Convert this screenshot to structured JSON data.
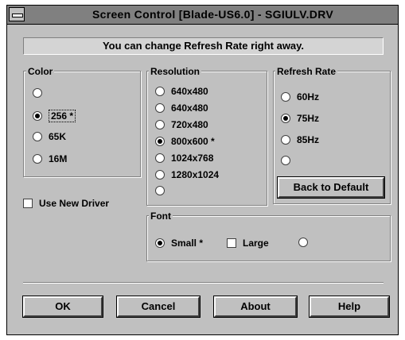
{
  "window": {
    "title": "Screen Control [Blade-US6.0] - SGIULV.DRV"
  },
  "info_message": "You can change Refresh Rate right away.",
  "color": {
    "title": "Color",
    "options": [
      {
        "label": "",
        "checked": false
      },
      {
        "label": "256 *",
        "checked": true
      },
      {
        "label": "65K",
        "checked": false
      },
      {
        "label": "16M",
        "checked": false
      }
    ]
  },
  "resolution": {
    "title": "Resolution",
    "options": [
      {
        "label": "640x480",
        "checked": false
      },
      {
        "label": "640x480",
        "checked": false
      },
      {
        "label": "720x480",
        "checked": false
      },
      {
        "label": "800x600 *",
        "checked": true
      },
      {
        "label": "1024x768",
        "checked": false
      },
      {
        "label": "1280x1024",
        "checked": false
      },
      {
        "label": "",
        "checked": false
      }
    ]
  },
  "refresh": {
    "title": "Refresh Rate",
    "options": [
      {
        "label": "60Hz",
        "checked": false
      },
      {
        "label": "75Hz",
        "checked": true
      },
      {
        "label": "85Hz",
        "checked": false
      },
      {
        "label": "",
        "checked": false
      }
    ],
    "back_label": "Back to Default"
  },
  "use_new_driver": {
    "label": "Use New Driver",
    "checked": false
  },
  "font": {
    "title": "Font",
    "small": "Small *",
    "large": "Large"
  },
  "buttons": {
    "ok": "OK",
    "cancel": "Cancel",
    "about": "About",
    "help": "Help"
  }
}
